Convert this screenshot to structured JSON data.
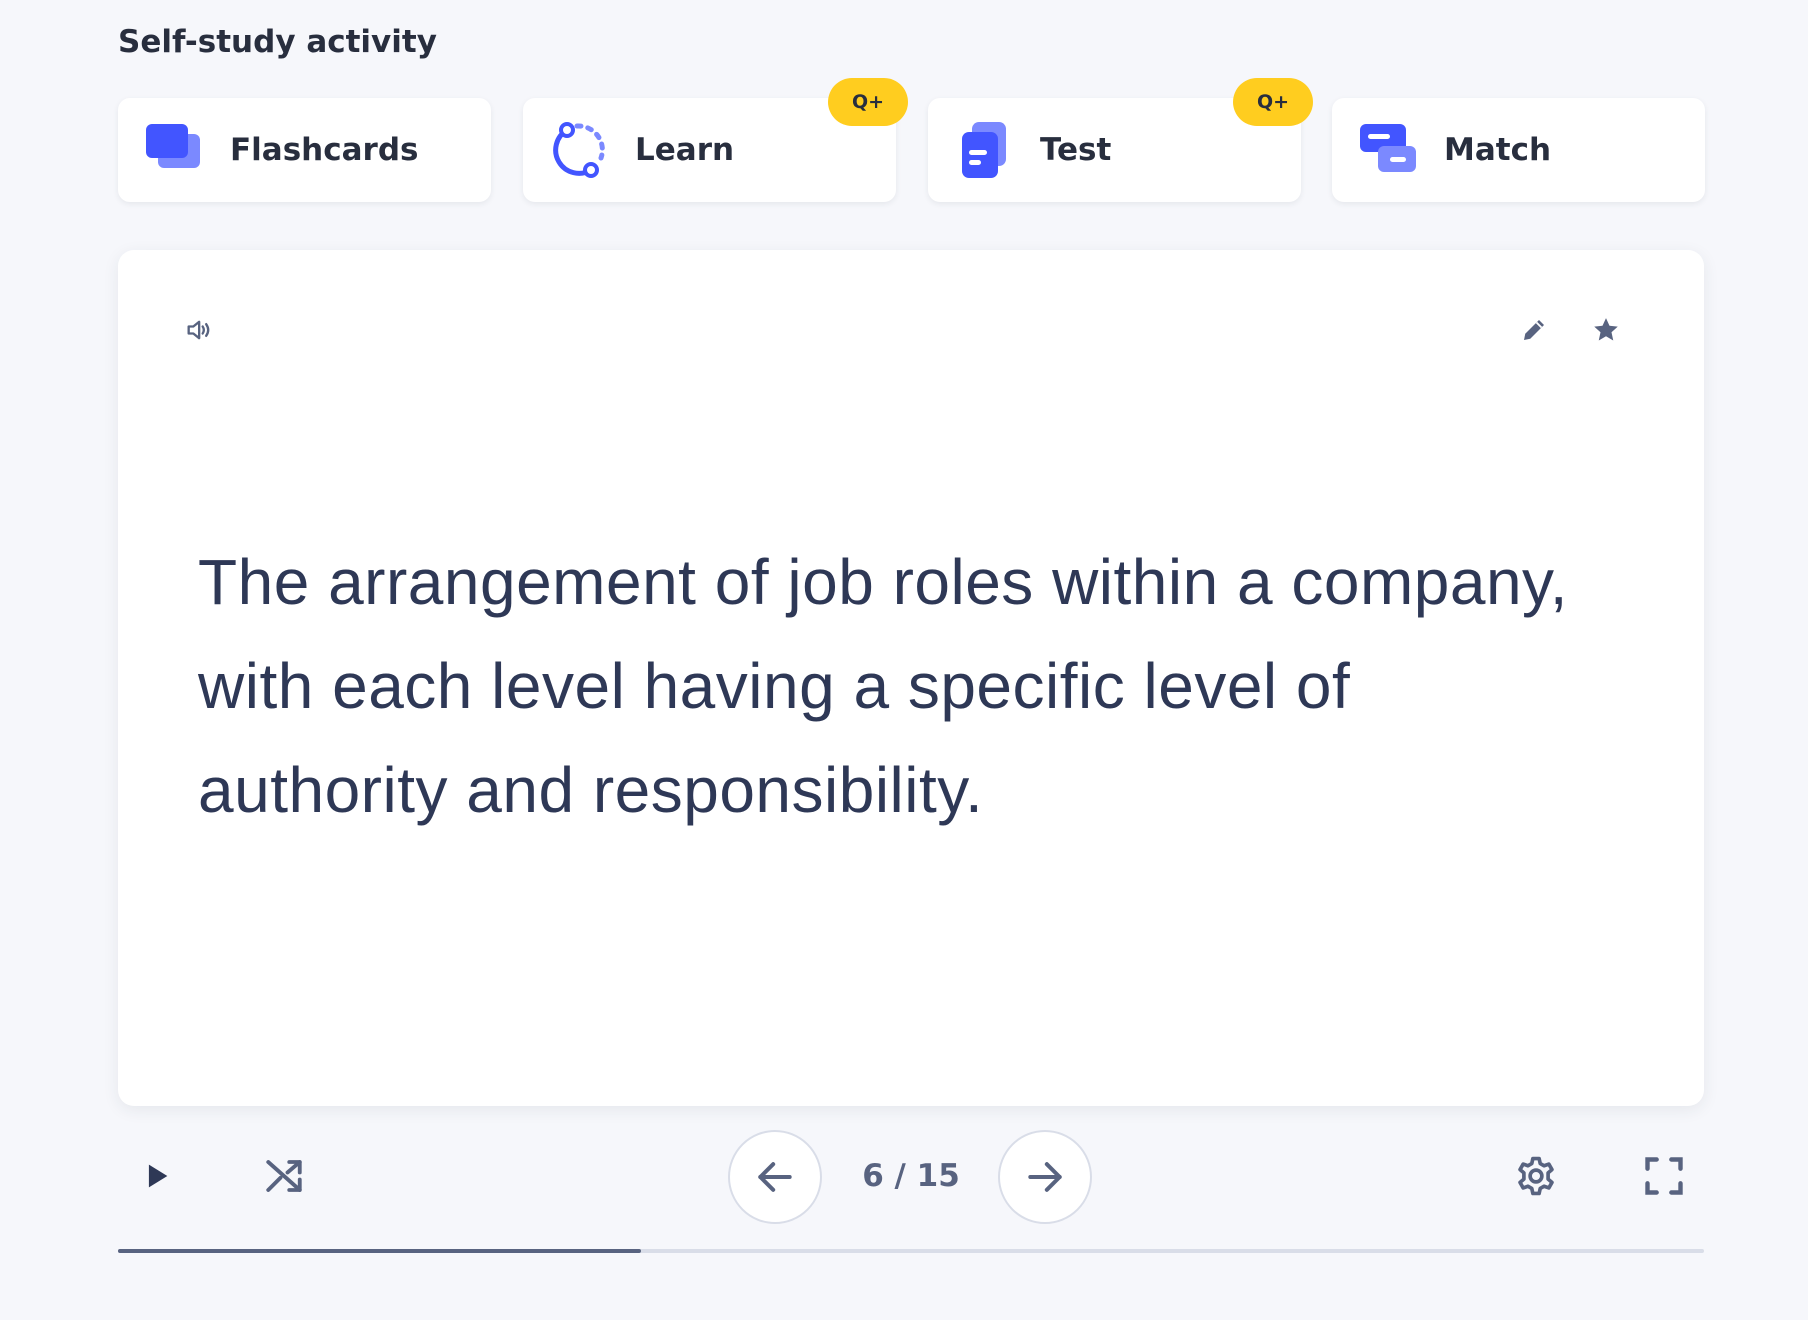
{
  "section": {
    "title": "Self-study activity"
  },
  "modes": [
    {
      "label": "Flashcards",
      "icon": "flashcards-icon",
      "badge": ""
    },
    {
      "label": "Learn",
      "icon": "learn-icon",
      "badge": "Q+"
    },
    {
      "label": "Test",
      "icon": "test-icon",
      "badge": "Q+"
    },
    {
      "label": "Match",
      "icon": "match-icon",
      "badge": ""
    }
  ],
  "card": {
    "text": "The arrangement of job roles within a company, with each level having a specific level of authority and responsibility.",
    "icons": [
      "speaker-icon",
      "pencil-icon",
      "star-icon"
    ]
  },
  "controls": {
    "counter": "6 / 15",
    "current": 6,
    "total": 15,
    "icons": [
      "play-icon",
      "shuffle-icon",
      "arrow-left-icon",
      "arrow-right-icon",
      "gear-icon",
      "fullscreen-icon"
    ]
  },
  "progress": {
    "fraction": 0.33
  },
  "colors": {
    "accent": "#4255ff",
    "accent_light": "#7b89ff",
    "badge": "#ffcd1f",
    "text": "#2e3856",
    "icon": "#586380"
  }
}
